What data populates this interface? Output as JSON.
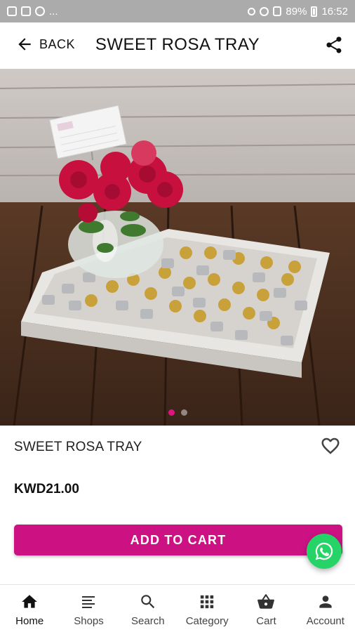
{
  "status_bar": {
    "battery": "89%",
    "time": "16:52",
    "ellipsis": "..."
  },
  "header": {
    "back_label": "BACK",
    "title": "SWEET ROSA TRAY"
  },
  "product": {
    "name": "SWEET ROSA TRAY",
    "price": "KWD21.00",
    "add_to_cart": "ADD TO CART",
    "image_count": 2,
    "active_image": 1
  },
  "nav": {
    "items": [
      {
        "label": "Home",
        "icon": "home-icon",
        "active": true
      },
      {
        "label": "Shops",
        "icon": "shops-list-icon"
      },
      {
        "label": "Search",
        "icon": "search-icon"
      },
      {
        "label": "Category",
        "icon": "category-grid-icon"
      },
      {
        "label": "Cart",
        "icon": "cart-basket-icon"
      },
      {
        "label": "Account",
        "icon": "account-person-icon"
      }
    ]
  },
  "colors": {
    "accent": "#cc1283",
    "dot_active": "#e0147f",
    "whatsapp": "#25d366",
    "status_bar": "#ababab"
  }
}
